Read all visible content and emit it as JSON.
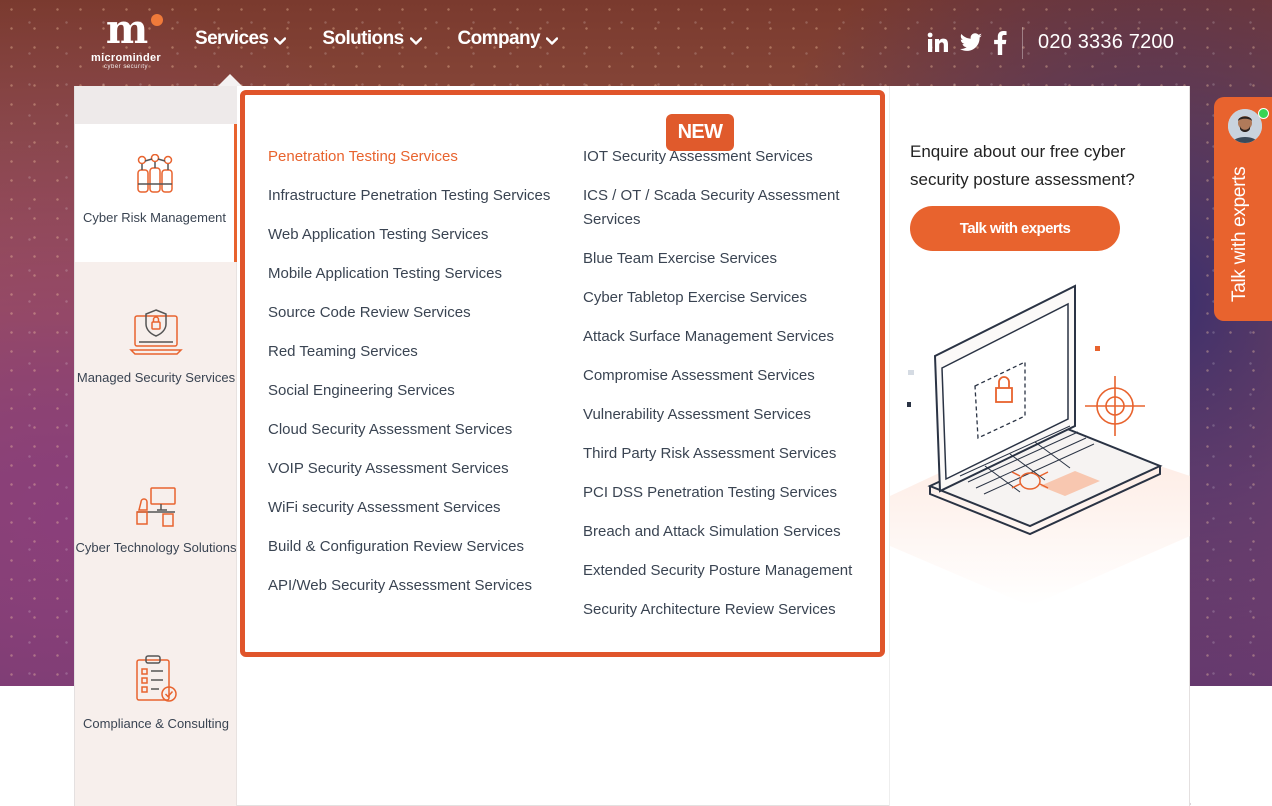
{
  "header": {
    "logo": {
      "mark": "m",
      "name": "microminder",
      "tagline": "cyber security"
    },
    "nav": [
      {
        "label": "Services"
      },
      {
        "label": "Solutions"
      },
      {
        "label": "Company"
      }
    ],
    "social": [
      "linkedin-icon",
      "twitter-icon",
      "facebook-icon"
    ],
    "phone": "020 3336 7200"
  },
  "sidebar": {
    "items": [
      {
        "label": "Cyber Risk Management",
        "icon": "hands-network-icon",
        "active": true
      },
      {
        "label": "Managed Security Services",
        "icon": "laptop-shield-icon",
        "active": false
      },
      {
        "label": "Cyber Technology Solutions",
        "icon": "workstation-icon",
        "active": false
      },
      {
        "label": "Compliance & Consulting",
        "icon": "checklist-icon",
        "active": false
      }
    ]
  },
  "services": {
    "badge": "NEW",
    "left": [
      "Penetration Testing Services",
      "Infrastructure Penetration Testing Services",
      "Web Application Testing Services",
      "Mobile Application Testing Services",
      "Source Code Review Services",
      "Red Teaming Services",
      "Social Engineering Services",
      "Cloud Security Assessment Services",
      "VOIP Security Assessment Services",
      "WiFi security Assessment Services",
      "Build & Configuration Review Services",
      "API/Web Security Assessment Services"
    ],
    "right": [
      "IOT Security Assessment Services",
      "ICS / OT / Scada Security Assessment Services",
      "Blue Team Exercise Services",
      "Cyber Tabletop Exercise Services",
      "Attack Surface Management Services",
      "Compromise Assessment Services",
      "Vulnerability Assessment Services",
      "Third Party Risk Assessment Services",
      "PCI DSS Penetration Testing Services",
      "Breach and Attack Simulation Services",
      "Extended Security Posture Management",
      "Security Architecture Review Services"
    ]
  },
  "promo": {
    "text": "Enquire about our free cyber security posture assessment?",
    "button": "Talk with experts"
  },
  "float_tab": {
    "label": "Talk with experts"
  },
  "colors": {
    "accent": "#e8632e",
    "badge": "#e05a2c",
    "text": "#3a4452"
  }
}
